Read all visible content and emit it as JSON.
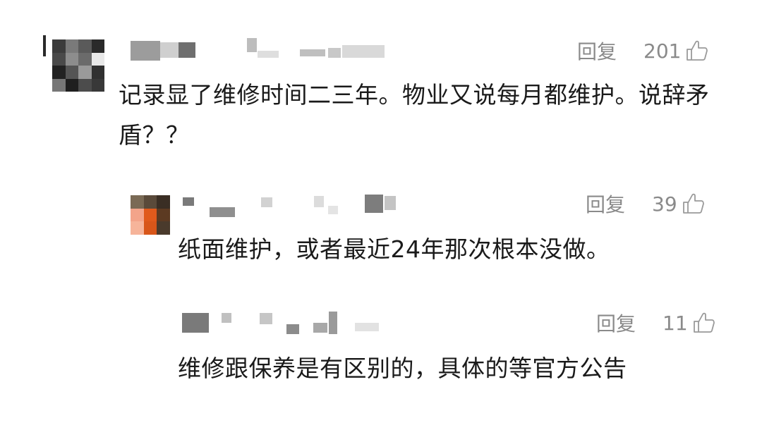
{
  "comments": [
    {
      "reply_label": "回复",
      "likes": "201",
      "text": "记录显了维修时间二三年。物业又说每月都维护。说辞矛盾？？",
      "avatar_colors": [
        "#3c3c3c",
        "#7a7a7a",
        "#5a5a5a",
        "#2a2a2a",
        "#4a4a4a",
        "#8d8d8d",
        "#6b6b6b",
        "#e8e8e8",
        "#222222",
        "#555555",
        "#9a9a9a",
        "#303030",
        "#777777",
        "#1f1f1f",
        "#4c4c4c",
        "#383838"
      ]
    },
    {
      "reply_label": "回复",
      "likes": "39",
      "text": "纸面维护，或者最近24年那次根本没做。",
      "avatar_colors": [
        "#7a6a55",
        "#5a4a3a",
        "#3a2e24",
        "#f3a48a",
        "#e05a1c",
        "#5c3a22",
        "#f6b49a",
        "#d8561a",
        "#4a3a2c"
      ]
    },
    {
      "reply_label": "回复",
      "likes": "11",
      "text": "维修跟保养是有区别的，具体的等官方公告"
    }
  ],
  "colors": {
    "text": "#1a1a1a",
    "meta": "#8a8a8a",
    "blur": "#c9c9c9"
  },
  "icons": {
    "like": "thumbs-up-icon"
  }
}
